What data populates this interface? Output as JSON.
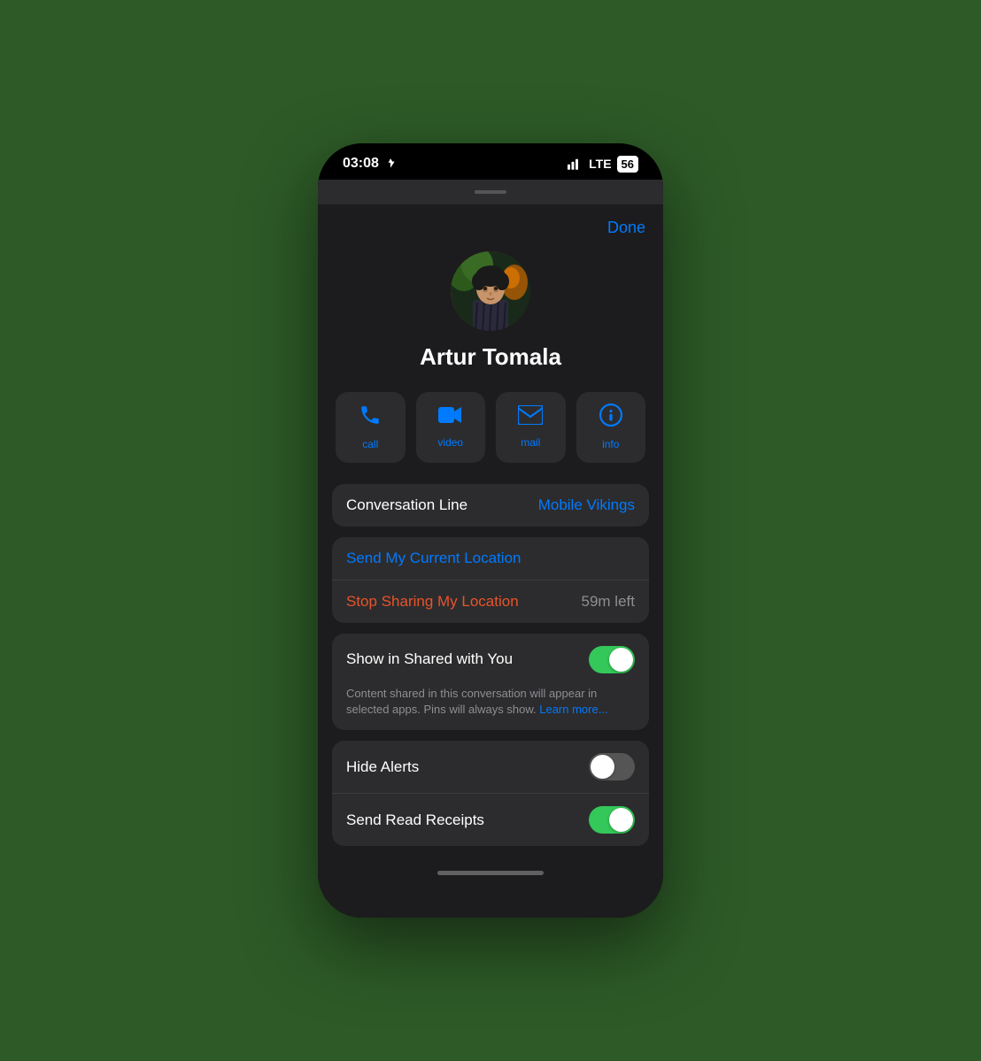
{
  "statusBar": {
    "time": "03:08",
    "signal": "●●● LTE",
    "battery": "56"
  },
  "header": {
    "doneLabel": "Done"
  },
  "profile": {
    "name": "Artur Tomala"
  },
  "actions": [
    {
      "id": "call",
      "icon": "📞",
      "label": "call"
    },
    {
      "id": "video",
      "icon": "📹",
      "label": "video"
    },
    {
      "id": "mail",
      "icon": "✉️",
      "label": "mail"
    },
    {
      "id": "info",
      "icon": "👤",
      "label": "info"
    }
  ],
  "conversationLine": {
    "label": "Conversation Line",
    "value": "Mobile Vikings"
  },
  "location": {
    "sendLabel": "Send My Current Location",
    "stopLabel": "Stop Sharing My Location",
    "timeLeft": "59m left"
  },
  "sharedWithYou": {
    "label": "Show in Shared with You",
    "description": "Content shared in this conversation will appear in selected apps. Pins will always show.",
    "learnMore": "Learn more...",
    "enabled": true
  },
  "hideAlerts": {
    "label": "Hide Alerts",
    "enabled": false
  },
  "sendReadReceipts": {
    "label": "Send Read Receipts",
    "enabled": true
  }
}
